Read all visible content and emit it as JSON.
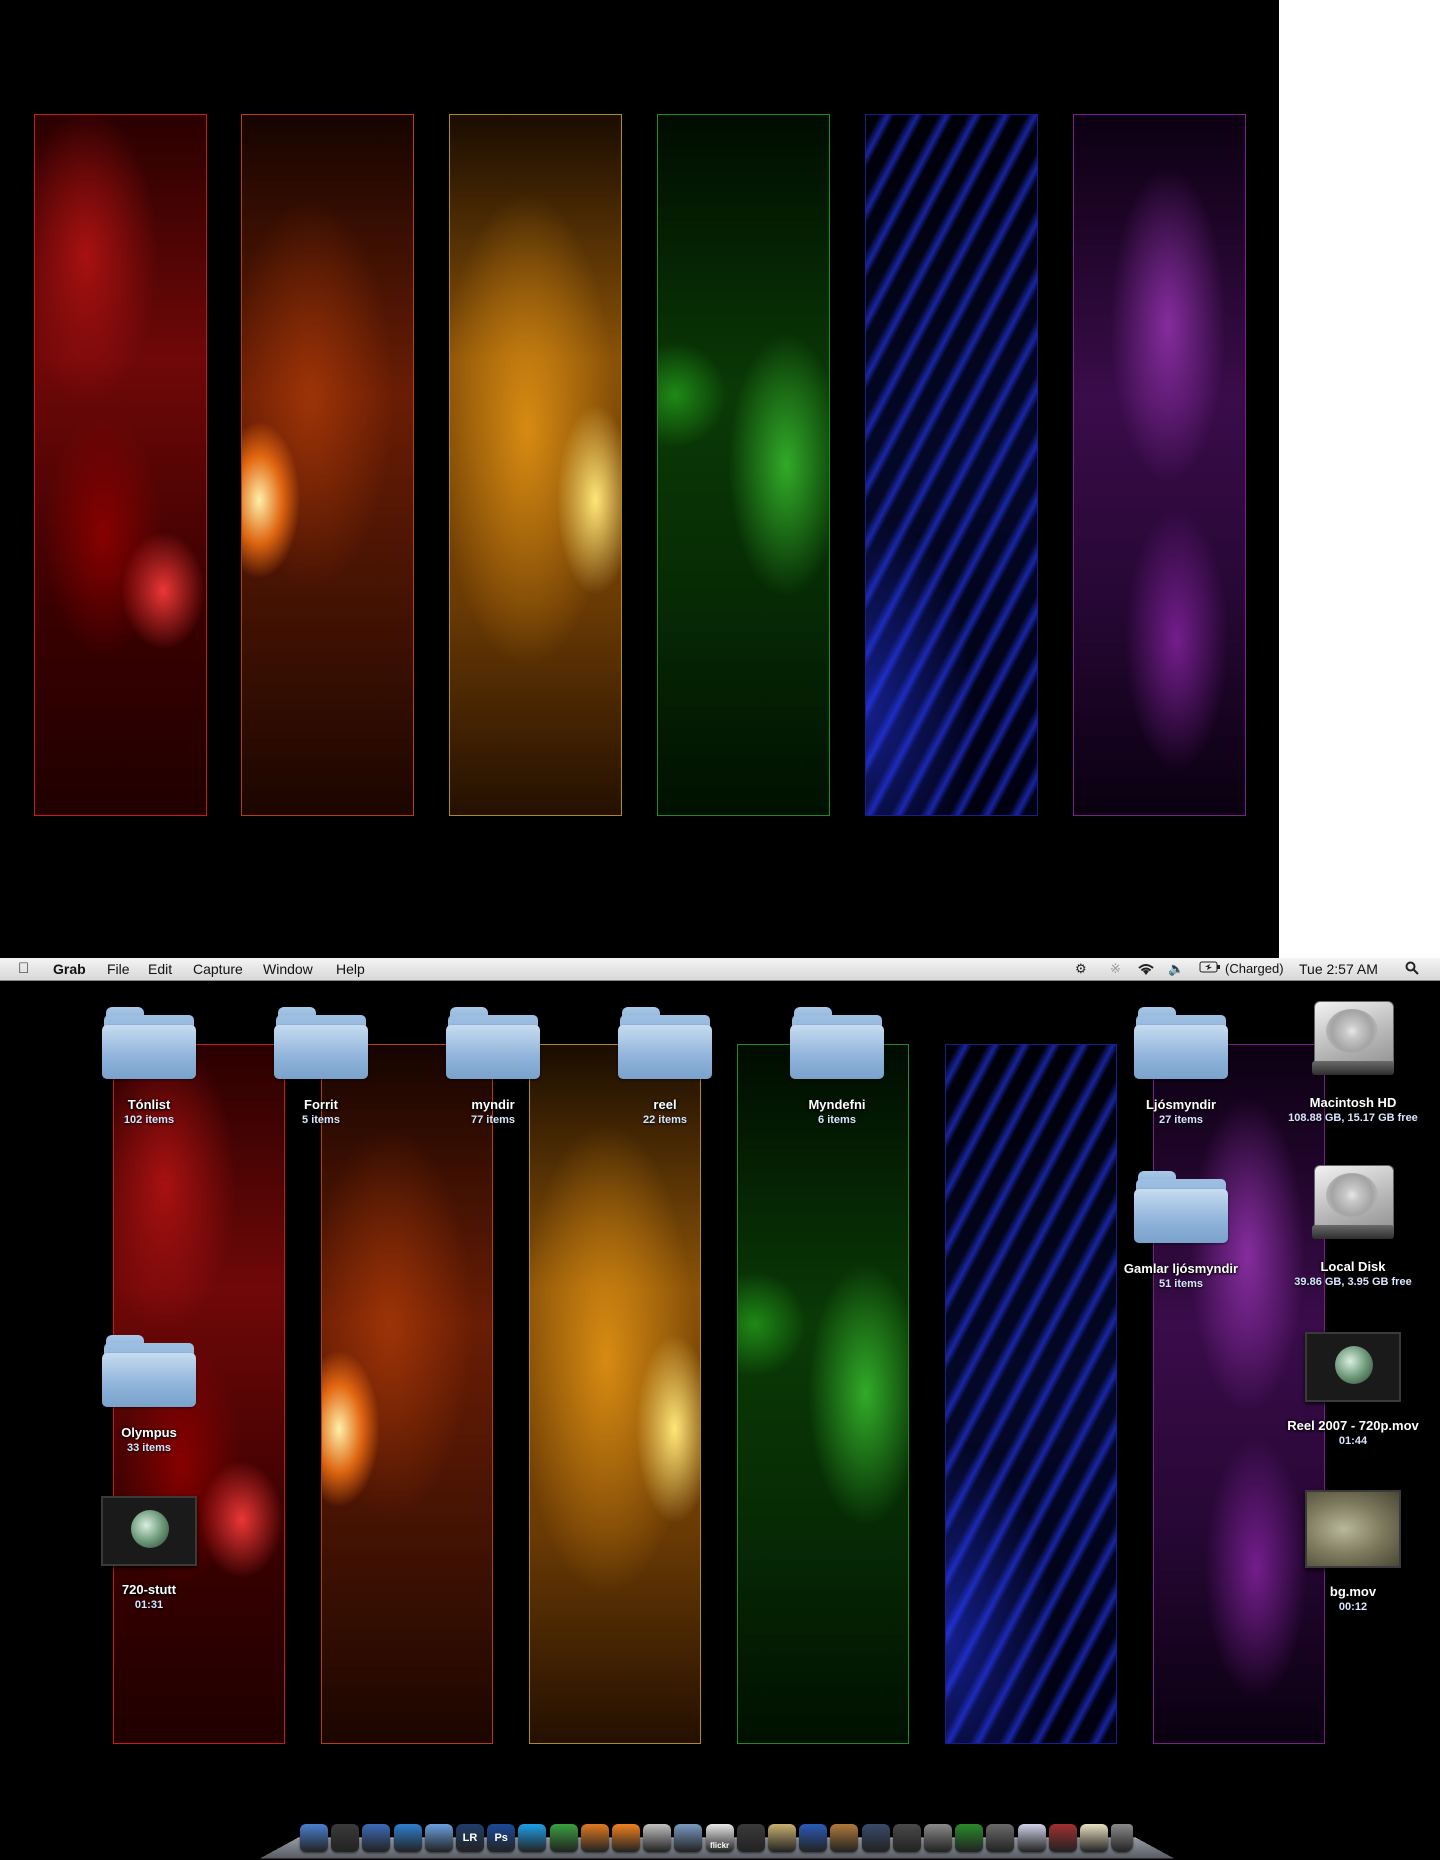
{
  "menubar": {
    "app_name": "Grab",
    "menus": [
      "File",
      "Edit",
      "Capture",
      "Window",
      "Help"
    ],
    "battery_status": "(Charged)",
    "clock": "Tue 2:57 AM",
    "status_icons": [
      "timemachine-icon",
      "bluetooth-icon",
      "wifi-icon",
      "volume-icon",
      "battery-icon",
      "spotlight-icon"
    ]
  },
  "wallpaper_panels": [
    {
      "color": "red",
      "border": "#c81a1a"
    },
    {
      "color": "orange",
      "border": "#b5400e"
    },
    {
      "color": "yellow",
      "border": "#b08a1a"
    },
    {
      "color": "green",
      "border": "#1f8a1f"
    },
    {
      "color": "blue",
      "border": "#1a1d8a"
    },
    {
      "color": "purple",
      "border": "#7a1f8a"
    }
  ],
  "desktop_icons": {
    "tonlist": {
      "name": "Tónlist",
      "info": "102 items",
      "type": "folder"
    },
    "forrit": {
      "name": "Forrit",
      "info": "5 items",
      "type": "folder"
    },
    "myndir": {
      "name": "myndir",
      "info": "77 items",
      "type": "folder"
    },
    "reel": {
      "name": "reel",
      "info": "22 items",
      "type": "folder"
    },
    "myndefni": {
      "name": "Myndefni",
      "info": "6 items",
      "type": "folder"
    },
    "ljosmyndir": {
      "name": "Ljósmyndir",
      "info": "27 items",
      "type": "folder"
    },
    "macintosh_hd": {
      "name": "Macintosh HD",
      "info": "108.88 GB, 15.17 GB free",
      "type": "hard-drive"
    },
    "gamlar": {
      "name": "Gamlar ljósmyndir",
      "info": "51 items",
      "type": "folder"
    },
    "local_disk": {
      "name": "Local Disk",
      "info": "39.86 GB, 3.95 GB free",
      "type": "hard-drive"
    },
    "olympus": {
      "name": "Olympus",
      "info": "33 items",
      "type": "folder"
    },
    "reel2007": {
      "name": "Reel 2007 - 720p.mov",
      "info": "01:44",
      "type": "movie"
    },
    "stutt": {
      "name": "720-stutt",
      "info": "01:31",
      "type": "movie"
    },
    "bgmov": {
      "name": "bg.mov",
      "info": "00:12",
      "type": "movie"
    }
  },
  "dock": {
    "items": [
      "finder-icon",
      "dashboard-icon",
      "preview-icon",
      "safari-icon",
      "itunes-icon",
      "lightroom-icon",
      "photoshop-icon",
      "skype-icon",
      "adium-icon",
      "blender-icon",
      "vlc-icon",
      "textwrangler-icon",
      "iphoto-icon",
      "transmit-icon",
      "final-cut-icon",
      "imovie-icon",
      "quicktime-icon",
      "garageband-icon",
      "expose-icon",
      "timemachine-icon",
      "system-preferences-icon",
      "xcode-icon",
      "app-store-icon",
      "documents-stack-icon",
      "applications-stack-icon",
      "downloads-stack-icon",
      "trash-icon"
    ],
    "label_flickr": "flickr",
    "label_lr": "LR",
    "label_ps": "Ps"
  }
}
